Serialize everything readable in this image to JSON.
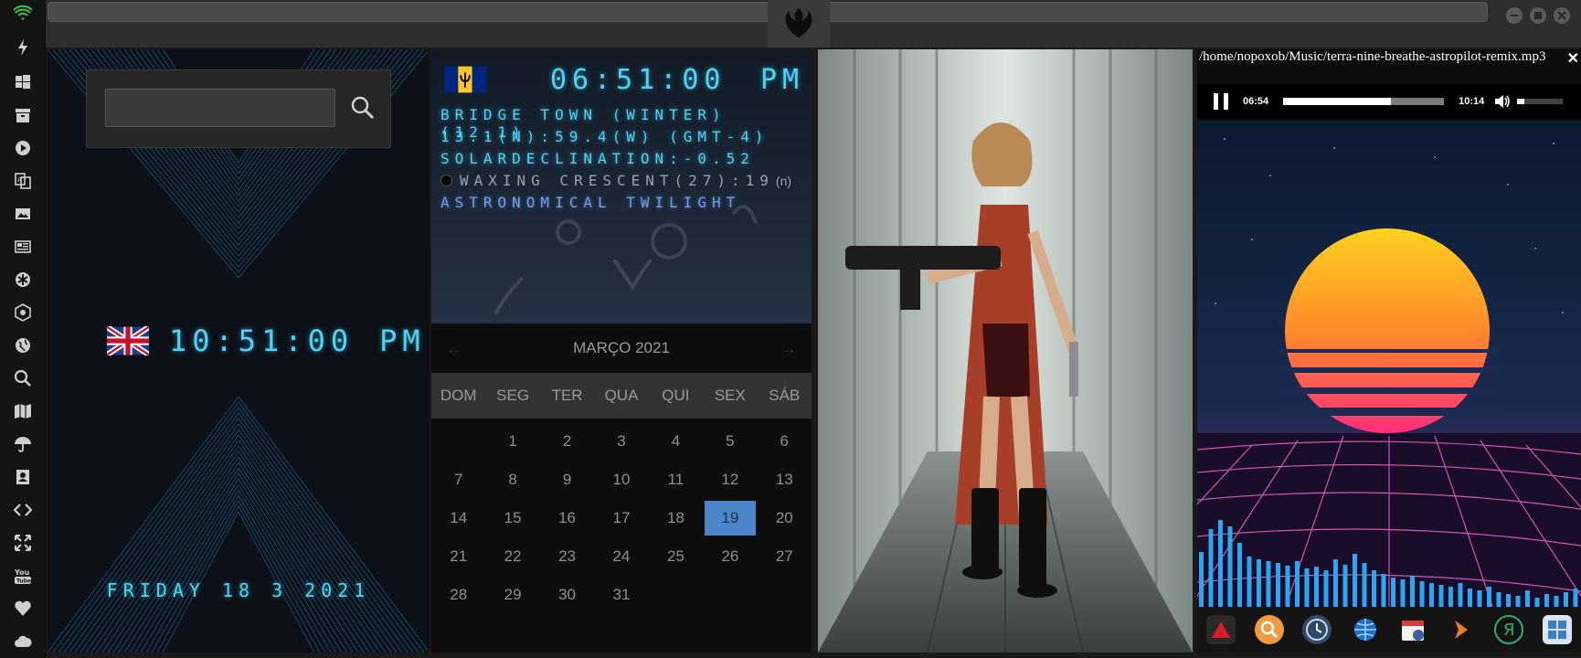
{
  "sidebar": {
    "icons": [
      "wifi-icon",
      "bolt-icon",
      "windows-icon",
      "archive-icon",
      "play-icon",
      "translate-icon",
      "image-icon",
      "news-icon",
      "asterisk-icon",
      "hexagon-icon",
      "globe-icon",
      "search-icon",
      "map-icon",
      "umbrella-icon",
      "contacts-icon",
      "code-icon",
      "expand-icon",
      "youtube-icon",
      "heart-icon",
      "cloud-icon"
    ]
  },
  "clock_panel": {
    "time": "10:51:00",
    "ampm": "PM",
    "date": "FRIDAY 18 3 2021",
    "search_placeholder": ""
  },
  "astro_panel": {
    "time": "06:51:00",
    "ampm": "PM",
    "location": "BRIDGE TOWN (WINTER)(12.1)",
    "coords": "13.1(N):59.4(W) (GMT-4)",
    "solar": "SOLARDECLINATION:-0.52",
    "moon": "WAXING CRESCENT(27):19",
    "moon_suffix": "(n)",
    "twilight": "ASTRONOMICAL TWILIGHT"
  },
  "calendar": {
    "month": "MARÇO 2021",
    "prev": "←",
    "next": "→",
    "weekdays": [
      "DOM",
      "SEG",
      "TER",
      "QUA",
      "QUI",
      "SEX",
      "SÁB"
    ],
    "leading_blanks": 1,
    "days": 31,
    "today": 19
  },
  "player": {
    "path": "/home/nopoxob/Music/terra-nine-breathe-astropilot-remix.mp3",
    "close": "✕",
    "elapsed": "06:54",
    "total": "10:14",
    "progress": 0.67,
    "volume": 0.15
  },
  "dock": {
    "icons": [
      "triangle-app-icon",
      "search-app-icon",
      "clock-app-icon",
      "globe-app-icon",
      "calendar-app-icon",
      "arrow-app-icon",
      "yandex-icon",
      "calculator-icon"
    ]
  },
  "colors": {
    "lcd": "#4fd3f4",
    "today": "#4a86c8"
  }
}
